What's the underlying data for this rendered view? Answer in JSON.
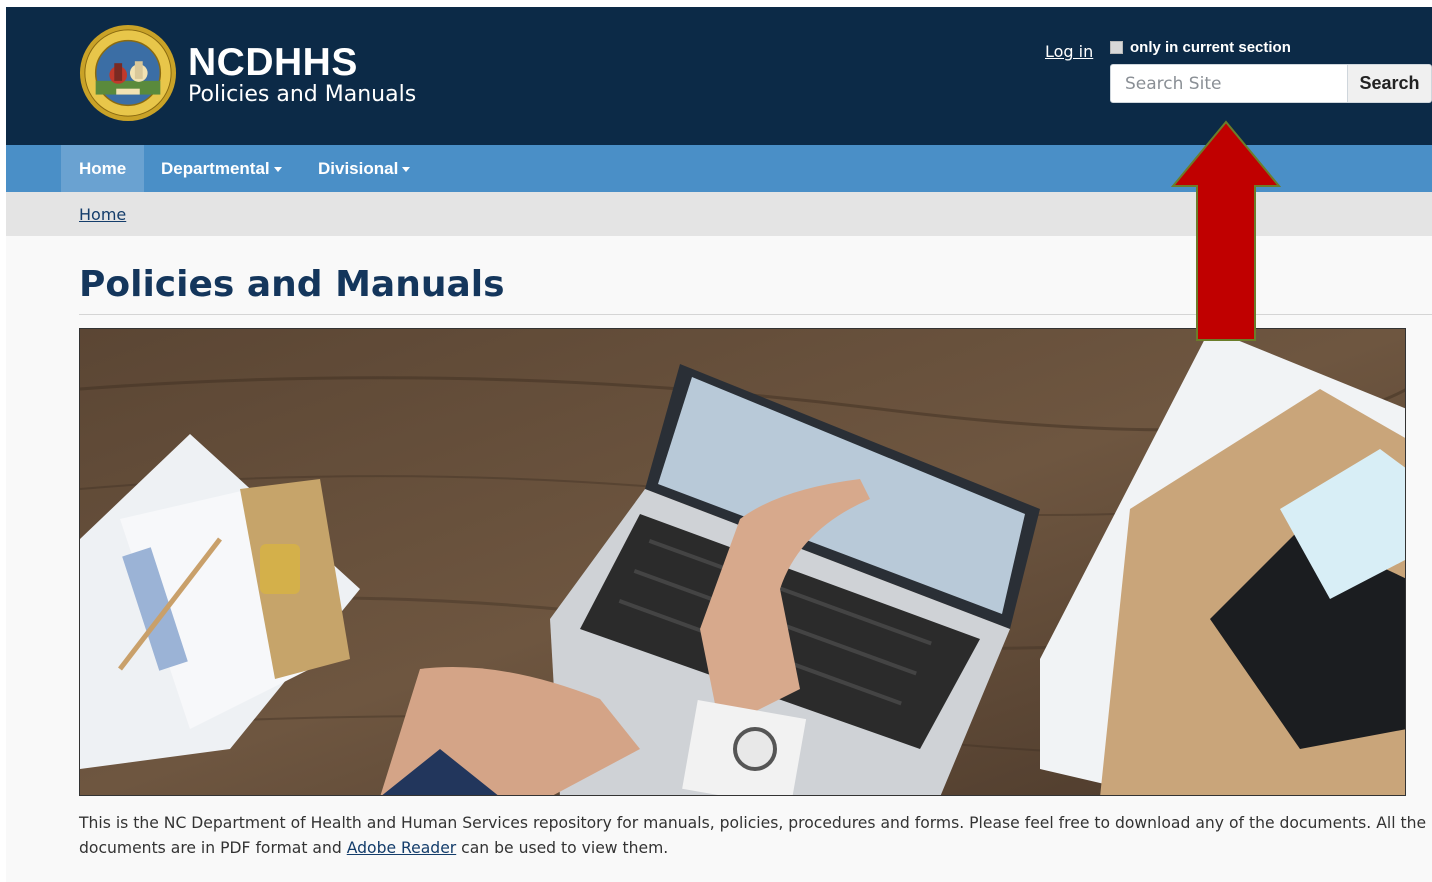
{
  "header": {
    "brand_title": "NCDHHS",
    "brand_subtitle": "Policies and Manuals",
    "seal_icon": "nc-state-seal-icon",
    "login_label": "Log in",
    "section_checkbox_label": "only in current section",
    "search_placeholder": "Search Site",
    "search_button_label": "Search"
  },
  "nav": {
    "items": [
      {
        "label": "Home",
        "active": true
      },
      {
        "label": "Departmental",
        "dropdown": true
      },
      {
        "label": "Divisional",
        "dropdown": true
      }
    ]
  },
  "breadcrumb": {
    "home_label": "Home"
  },
  "main": {
    "title": "Policies and Manuals",
    "hero_image": "laptop-desk-photo",
    "intro_text_1": "This is the NC Department of Health and Human Services repository for manuals, policies, procedures and forms. Please feel free to download any of the documents. All the documents are in PDF format and ",
    "intro_link": "Adobe Reader",
    "intro_text_2": " can be used to view them."
  },
  "annotation": {
    "arrow_icon": "red-up-arrow-icon",
    "arrow_color": "#c00000"
  },
  "colors": {
    "header_bg": "#0c2a47",
    "nav_bg": "#4a8fc7",
    "nav_active_bg": "#6aa2d1",
    "breadcrumb_bg": "#e4e4e4",
    "title_color": "#14365c"
  }
}
